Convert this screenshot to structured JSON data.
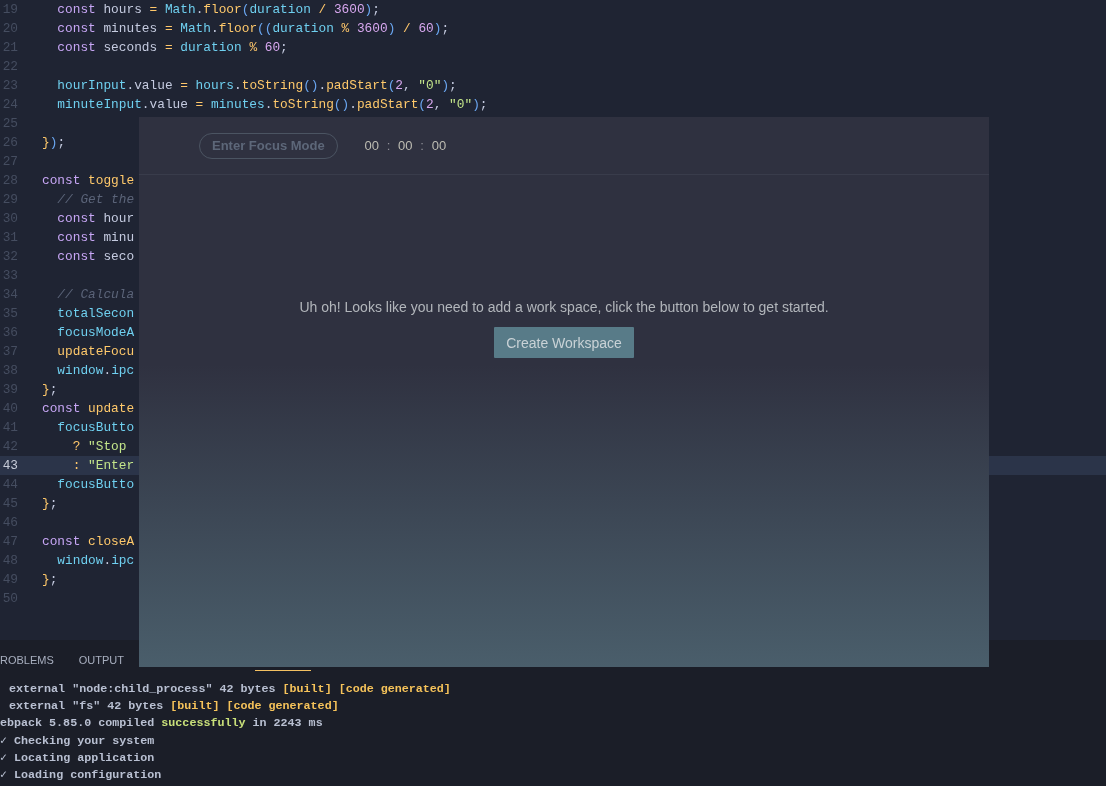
{
  "editor": {
    "lines": [
      {
        "number": "19",
        "current": false,
        "tokens": [
          {
            "text": "  const",
            "kind": "kw"
          },
          {
            "text": " hours ",
            "kind": "var"
          },
          {
            "text": "=",
            "kind": "op"
          },
          {
            "text": " Math",
            "kind": "id"
          },
          {
            "text": ".",
            "kind": "punc"
          },
          {
            "text": "floor",
            "kind": "fn"
          },
          {
            "text": "(",
            "kind": "paren"
          },
          {
            "text": "duration",
            "kind": "id"
          },
          {
            "text": " / ",
            "kind": "op"
          },
          {
            "text": "3600",
            "kind": "num"
          },
          {
            "text": ")",
            "kind": "paren"
          },
          {
            "text": ";",
            "kind": "punc"
          }
        ]
      },
      {
        "number": "20",
        "current": false,
        "tokens": [
          {
            "text": "  const",
            "kind": "kw"
          },
          {
            "text": " minutes ",
            "kind": "var"
          },
          {
            "text": "=",
            "kind": "op"
          },
          {
            "text": " Math",
            "kind": "id"
          },
          {
            "text": ".",
            "kind": "punc"
          },
          {
            "text": "floor",
            "kind": "fn"
          },
          {
            "text": "((",
            "kind": "paren"
          },
          {
            "text": "duration",
            "kind": "id"
          },
          {
            "text": " % ",
            "kind": "op"
          },
          {
            "text": "3600",
            "kind": "num"
          },
          {
            "text": ")",
            "kind": "paren"
          },
          {
            "text": " / ",
            "kind": "op"
          },
          {
            "text": "60",
            "kind": "num"
          },
          {
            "text": ")",
            "kind": "paren"
          },
          {
            "text": ";",
            "kind": "punc"
          }
        ]
      },
      {
        "number": "21",
        "current": false,
        "tokens": [
          {
            "text": "  const",
            "kind": "kw"
          },
          {
            "text": " seconds ",
            "kind": "var"
          },
          {
            "text": "=",
            "kind": "op"
          },
          {
            "text": " duration",
            "kind": "id"
          },
          {
            "text": " % ",
            "kind": "op"
          },
          {
            "text": "60",
            "kind": "num"
          },
          {
            "text": ";",
            "kind": "punc"
          }
        ]
      },
      {
        "number": "22",
        "current": false
      },
      {
        "number": "23",
        "current": false,
        "tokens": [
          {
            "text": "  hourInput",
            "kind": "id"
          },
          {
            "text": ".",
            "kind": "punc"
          },
          {
            "text": "value ",
            "kind": "var"
          },
          {
            "text": "=",
            "kind": "op"
          },
          {
            "text": " hours",
            "kind": "id"
          },
          {
            "text": ".",
            "kind": "punc"
          },
          {
            "text": "toString",
            "kind": "fn"
          },
          {
            "text": "()",
            "kind": "paren"
          },
          {
            "text": ".",
            "kind": "punc"
          },
          {
            "text": "padStart",
            "kind": "fn"
          },
          {
            "text": "(",
            "kind": "paren"
          },
          {
            "text": "2",
            "kind": "num"
          },
          {
            "text": ", ",
            "kind": "punc"
          },
          {
            "text": "\"0\"",
            "kind": "str"
          },
          {
            "text": ")",
            "kind": "paren"
          },
          {
            "text": ";",
            "kind": "punc"
          }
        ]
      },
      {
        "number": "24",
        "current": false,
        "tokens": [
          {
            "text": "  minuteInput",
            "kind": "id"
          },
          {
            "text": ".",
            "kind": "punc"
          },
          {
            "text": "value ",
            "kind": "var"
          },
          {
            "text": "=",
            "kind": "op"
          },
          {
            "text": " minutes",
            "kind": "id"
          },
          {
            "text": ".",
            "kind": "punc"
          },
          {
            "text": "toString",
            "kind": "fn"
          },
          {
            "text": "()",
            "kind": "paren"
          },
          {
            "text": ".",
            "kind": "punc"
          },
          {
            "text": "padStart",
            "kind": "fn"
          },
          {
            "text": "(",
            "kind": "paren"
          },
          {
            "text": "2",
            "kind": "num"
          },
          {
            "text": ", ",
            "kind": "punc"
          },
          {
            "text": "\"0\"",
            "kind": "str"
          },
          {
            "text": ")",
            "kind": "paren"
          },
          {
            "text": ";",
            "kind": "punc"
          }
        ]
      },
      {
        "number": "25",
        "current": false
      },
      {
        "number": "26",
        "current": false,
        "tokens": [
          {
            "text": "}",
            "kind": "fn"
          },
          {
            "text": ")",
            "kind": "paren"
          },
          {
            "text": ";",
            "kind": "punc"
          }
        ]
      },
      {
        "number": "27",
        "current": false
      },
      {
        "number": "28",
        "current": false,
        "tokens": [
          {
            "text": "const",
            "kind": "kw"
          },
          {
            "text": " toggle",
            "kind": "fn"
          }
        ]
      },
      {
        "number": "29",
        "current": false,
        "tokens": [
          {
            "text": "  // Get the",
            "kind": "com"
          }
        ]
      },
      {
        "number": "30",
        "current": false,
        "tokens": [
          {
            "text": "  const",
            "kind": "kw"
          },
          {
            "text": " hour",
            "kind": "var"
          }
        ]
      },
      {
        "number": "31",
        "current": false,
        "tokens": [
          {
            "text": "  const",
            "kind": "kw"
          },
          {
            "text": " minu",
            "kind": "var"
          }
        ]
      },
      {
        "number": "32",
        "current": false,
        "tokens": [
          {
            "text": "  const",
            "kind": "kw"
          },
          {
            "text": " seco",
            "kind": "var"
          }
        ]
      },
      {
        "number": "33",
        "current": false
      },
      {
        "number": "34",
        "current": false,
        "tokens": [
          {
            "text": "  // Calcula",
            "kind": "com"
          }
        ]
      },
      {
        "number": "35",
        "current": false,
        "tokens": [
          {
            "text": "  totalSecon",
            "kind": "id"
          }
        ]
      },
      {
        "number": "36",
        "current": false,
        "tokens": [
          {
            "text": "  focusModeA",
            "kind": "id"
          }
        ]
      },
      {
        "number": "37",
        "current": false,
        "tokens": [
          {
            "text": "  updateFocu",
            "kind": "fn"
          }
        ]
      },
      {
        "number": "38",
        "current": false,
        "tokens": [
          {
            "text": "  window",
            "kind": "id"
          },
          {
            "text": ".",
            "kind": "punc"
          },
          {
            "text": "ipc",
            "kind": "id"
          }
        ]
      },
      {
        "number": "39",
        "current": false,
        "tokens": [
          {
            "text": "}",
            "kind": "fn"
          },
          {
            "text": ";",
            "kind": "punc"
          }
        ]
      },
      {
        "number": "40",
        "current": false,
        "tokens": [
          {
            "text": "const",
            "kind": "kw"
          },
          {
            "text": " update",
            "kind": "fn"
          }
        ]
      },
      {
        "number": "41",
        "current": false,
        "tokens": [
          {
            "text": "  focusButto",
            "kind": "id"
          }
        ]
      },
      {
        "number": "42",
        "current": false,
        "tokens": [
          {
            "text": "    ?",
            "kind": "op"
          },
          {
            "text": " \"Stop",
            "kind": "str"
          }
        ]
      },
      {
        "number": "43",
        "current": true,
        "tokens": [
          {
            "text": "    :",
            "kind": "op"
          },
          {
            "text": " \"Enter",
            "kind": "str"
          }
        ]
      },
      {
        "number": "44",
        "current": false,
        "tokens": [
          {
            "text": "  focusButto",
            "kind": "id"
          }
        ]
      },
      {
        "number": "45",
        "current": false,
        "tokens": [
          {
            "text": "}",
            "kind": "fn"
          },
          {
            "text": ";",
            "kind": "punc"
          }
        ]
      },
      {
        "number": "46",
        "current": false
      },
      {
        "number": "47",
        "current": false,
        "tokens": [
          {
            "text": "const",
            "kind": "kw"
          },
          {
            "text": " closeA",
            "kind": "fn"
          }
        ]
      },
      {
        "number": "48",
        "current": false,
        "tokens": [
          {
            "text": "  window",
            "kind": "id"
          },
          {
            "text": ".",
            "kind": "punc"
          },
          {
            "text": "ipc",
            "kind": "id"
          }
        ]
      },
      {
        "number": "49",
        "current": false,
        "tokens": [
          {
            "text": "}",
            "kind": "fn"
          },
          {
            "text": ";",
            "kind": "punc"
          }
        ]
      },
      {
        "number": "50",
        "current": false
      }
    ]
  },
  "panel": {
    "tabs": [
      {
        "label": "ROBLEMS",
        "selected": false
      },
      {
        "label": "OUTPUT",
        "selected": false
      },
      {
        "selected": true
      }
    ],
    "terminal": [
      [
        {
          "text": " external \"node:child_process\" 42 bytes ",
          "kind": "plain"
        },
        {
          "text": "[built] [code generated]",
          "kind": "built"
        }
      ],
      [
        {
          "text": " external \"fs\" 42 bytes ",
          "kind": "plain"
        },
        {
          "text": "[built] [code generated]",
          "kind": "built"
        }
      ],
      [
        {
          "text": "ebpack 5.85.0 compiled ",
          "kind": "plain"
        },
        {
          "text": "successfully",
          "kind": "success"
        },
        {
          "text": " in 2243 ms",
          "kind": "plain"
        }
      ],
      [
        {
          "text": "✓ Checking your system",
          "kind": "plain"
        }
      ],
      [
        {
          "text": "✓ Locating application",
          "kind": "plain"
        }
      ],
      [
        {
          "text": "✓ Loading configuration",
          "kind": "plain"
        }
      ]
    ]
  },
  "app": {
    "focus_button": "Enter Focus Mode",
    "timer": {
      "fields": [
        "00",
        "00",
        "00"
      ],
      "separators": [
        ":",
        ":"
      ]
    },
    "message": "Uh oh! Looks like you need to add a work space, click the button below to get started.",
    "create_button": "Create Workspace"
  }
}
